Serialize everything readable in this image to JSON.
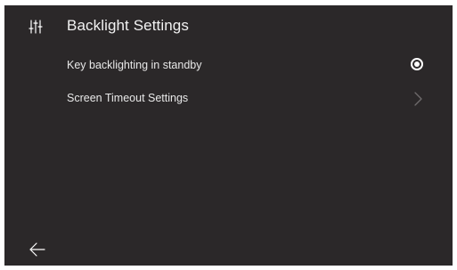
{
  "header": {
    "title": "Backlight Settings",
    "icon": "sliders-icon"
  },
  "settings": [
    {
      "label": "Key backlighting in standby",
      "control": "radio",
      "selected": true
    },
    {
      "label": "Screen Timeout Settings",
      "control": "chevron"
    }
  ],
  "footer": {
    "back_icon": "back-arrow-icon"
  },
  "colors": {
    "background": "#2b2829",
    "text": "#f2f2f2",
    "chevron": "#6f6c6d"
  }
}
